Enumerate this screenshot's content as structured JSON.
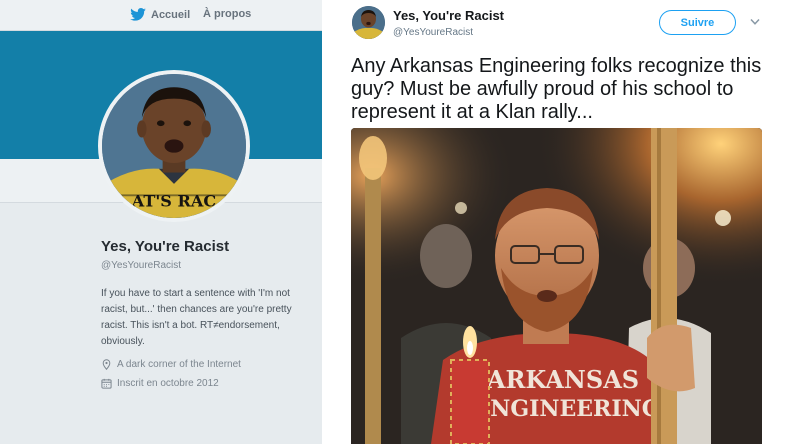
{
  "profile_page": {
    "nav": {
      "home_label": "Accueil",
      "about_label": "À propos",
      "icon": "twitter-bird-icon"
    },
    "avatar_shirt_text": "AT'S RAC",
    "display_name": "Yes, You're Racist",
    "handle": "@YesYoureRacist",
    "bio": "If you have to start a sentence with 'I'm not racist, but...' then chances are you're pretty racist. This isn't a bot. RT≠endorsement, obviously.",
    "location": {
      "icon": "location-pin-icon",
      "text": "A dark corner of the Internet"
    },
    "joined": {
      "icon": "calendar-icon",
      "text": "Inscrit en octobre 2012"
    },
    "colors": {
      "banner": "#137fa8",
      "page_background": "#e6ebee"
    }
  },
  "tweet": {
    "author_name": "Yes, You're Racist",
    "author_handle": "@YesYoureRacist",
    "follow_label": "Suivre",
    "menu_icon": "chevron-down-icon",
    "text": "Any Arkansas Engineering folks recognize this guy? Must be awfully proud of his school to represent it at a Klan rally...",
    "photo": {
      "shirt_line1": "ARKANSAS",
      "shirt_line2": "ENGINEERING"
    },
    "colors": {
      "accent": "#1da1f2",
      "text": "#14171a",
      "secondary_text": "#657786"
    }
  }
}
